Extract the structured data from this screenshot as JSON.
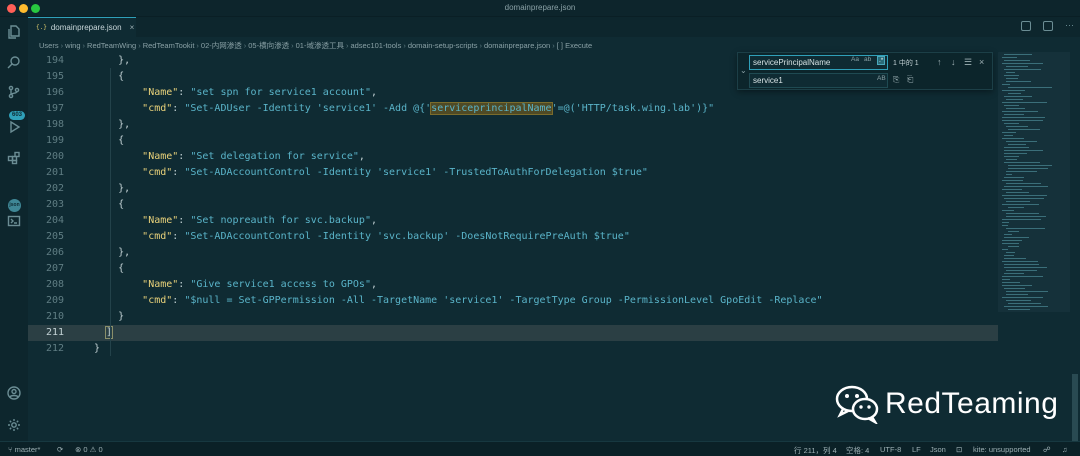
{
  "window": {
    "title": "domainprepare.json"
  },
  "activity": {
    "icons": [
      "files-icon",
      "search-icon",
      "source-control-icon",
      "run-debug-icon",
      "extensions-icon",
      "json-icon",
      "terminal-icon",
      "account-icon",
      "settings-gear-icon"
    ],
    "scm_badge": "603",
    "json_label": "json"
  },
  "tab": {
    "icon": "{.}",
    "label": "domainprepare.json",
    "close": "×"
  },
  "breadcrumb": [
    "Users",
    "wing",
    "RedTeamWing",
    "RedTeamTookit",
    "02-内网渗透",
    "05-横向渗透",
    "01-域渗透工具",
    "adsec101-tools",
    "domain-setup-scripts",
    "domainprepare.json",
    "[ ] Execute"
  ],
  "editor": {
    "lines": [
      {
        "n": "194",
        "parts": [
          [
            "p",
            "    },"
          ]
        ]
      },
      {
        "n": "195",
        "parts": [
          [
            "p",
            "    {"
          ]
        ]
      },
      {
        "n": "196",
        "parts": [
          [
            "p",
            "        "
          ],
          [
            "k",
            "\"Name\""
          ],
          [
            "p",
            ": "
          ],
          [
            "s",
            "\"set spn for service1 account\""
          ],
          [
            "p",
            ","
          ]
        ]
      },
      {
        "n": "197",
        "parts": [
          [
            "p",
            "        "
          ],
          [
            "k",
            "\"cmd\""
          ],
          [
            "p",
            ": "
          ],
          [
            "s",
            "\"Set-ADUser -Identity 'service1' -Add @{'"
          ],
          [
            "hl",
            "serviceprincipalName"
          ],
          [
            "s",
            "'=@('HTTP/task.wing.lab')}\""
          ]
        ]
      },
      {
        "n": "198",
        "parts": [
          [
            "p",
            "    },"
          ]
        ]
      },
      {
        "n": "199",
        "parts": [
          [
            "p",
            "    {"
          ]
        ]
      },
      {
        "n": "200",
        "parts": [
          [
            "p",
            "        "
          ],
          [
            "k",
            "\"Name\""
          ],
          [
            "p",
            ": "
          ],
          [
            "s",
            "\"Set delegation for service\""
          ],
          [
            "p",
            ","
          ]
        ]
      },
      {
        "n": "201",
        "parts": [
          [
            "p",
            "        "
          ],
          [
            "k",
            "\"cmd\""
          ],
          [
            "p",
            ": "
          ],
          [
            "s",
            "\"Set-ADAccountControl -Identity 'service1' -TrustedToAuthForDelegation $true\""
          ]
        ]
      },
      {
        "n": "202",
        "parts": [
          [
            "p",
            "    },"
          ]
        ]
      },
      {
        "n": "203",
        "parts": [
          [
            "p",
            "    {"
          ]
        ]
      },
      {
        "n": "204",
        "parts": [
          [
            "p",
            "        "
          ],
          [
            "k",
            "\"Name\""
          ],
          [
            "p",
            ": "
          ],
          [
            "s",
            "\"Set nopreauth for svc.backup\""
          ],
          [
            "p",
            ","
          ]
        ]
      },
      {
        "n": "205",
        "parts": [
          [
            "p",
            "        "
          ],
          [
            "k",
            "\"cmd\""
          ],
          [
            "p",
            ": "
          ],
          [
            "s",
            "\"Set-ADAccountControl -Identity 'svc.backup' -DoesNotRequirePreAuth $true\""
          ]
        ]
      },
      {
        "n": "206",
        "parts": [
          [
            "p",
            "    },"
          ]
        ]
      },
      {
        "n": "207",
        "parts": [
          [
            "p",
            "    {"
          ]
        ]
      },
      {
        "n": "208",
        "parts": [
          [
            "p",
            "        "
          ],
          [
            "k",
            "\"Name\""
          ],
          [
            "p",
            ": "
          ],
          [
            "s",
            "\"Give service1 access to GPOs\""
          ],
          [
            "p",
            ","
          ]
        ]
      },
      {
        "n": "209",
        "parts": [
          [
            "p",
            "        "
          ],
          [
            "k",
            "\"cmd\""
          ],
          [
            "p",
            ": "
          ],
          [
            "s",
            "\"$null = Set-GPPermission -All -TargetName 'service1' -TargetType Group -PermissionLevel GpoEdit -Replace\""
          ]
        ]
      },
      {
        "n": "210",
        "parts": [
          [
            "p",
            "    }"
          ]
        ]
      },
      {
        "n": "211",
        "parts": [
          [
            "p",
            "  "
          ],
          [
            "bh",
            "]"
          ]
        ]
      },
      {
        "n": "212",
        "parts": [
          [
            "p",
            "}"
          ]
        ]
      }
    ],
    "current_line": "211"
  },
  "find": {
    "toggle": "⌄",
    "query": "servicePrincipalName",
    "replace": "service1",
    "opt_case": "Aa",
    "opt_word": "ab",
    "opt_regex": ".*",
    "count": "1 中的 1",
    "prev": "↑",
    "next": "↓",
    "selection": "☰",
    "close": "×",
    "preserve_case": "AB",
    "replace_one": "⎘",
    "replace_all": "⎗"
  },
  "statusbar": {
    "branch": "master*",
    "sync": "⟳",
    "errors": "0",
    "warnings": "0",
    "position": "行 211，列 4",
    "spaces": "空格: 4",
    "encoding": "UTF-8",
    "eol": "LF",
    "language": "Json",
    "kite": "kite: unsupported"
  },
  "watermark": {
    "text": "RedTeaming"
  }
}
